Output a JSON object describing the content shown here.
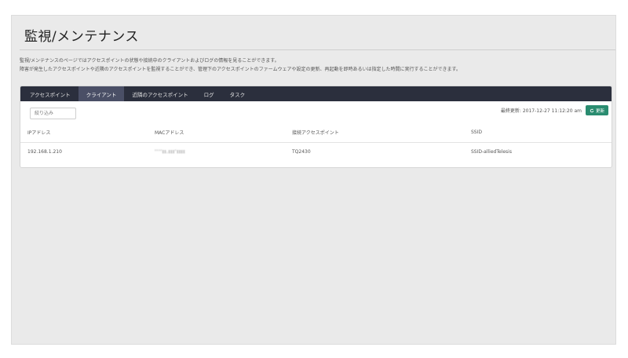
{
  "header": {
    "title": "監視/メンテナンス",
    "description": [
      "監視/メンテナンスのページではアクセスポイントの状態や接続中のクライアントおよびログの情報を見ることができます。",
      "障害が発生したアクセスポイントや近隣のアクセスポイントを監視することができ、管理下のアクセスポイントのファームウェアや設定の更新、再起動を即時あるいは指定した時間に実行することができます。"
    ]
  },
  "tabs": [
    {
      "label": "アクセスポイント",
      "active": false
    },
    {
      "label": "クライアント",
      "active": true
    },
    {
      "label": "近隣のアクセスポイント",
      "active": false
    },
    {
      "label": "ログ",
      "active": false
    },
    {
      "label": "タスク",
      "active": false
    }
  ],
  "toolbar": {
    "filter_placeholder": "絞り込み",
    "last_updated": "最終更新: 2017-12-27 11:12:20 am",
    "refresh_label": "更新",
    "refresh_icon": "refresh-icon",
    "refresh_color": "#2a8c70"
  },
  "table": {
    "columns": [
      "IPアドレス",
      "MACアドレス",
      "接続アクセスポイント",
      "SSID"
    ],
    "rows": [
      [
        "192.168.1.210",
        "ʻʻʻʻɪɪ.ɪɪɪʼɪɪɪɪ",
        "TQ2430",
        "SSID-alliedTelesis"
      ]
    ]
  },
  "colors": {
    "tab_bar": "#2b2f3d",
    "tab_active": "#4a4f66",
    "background": "#eaeaea"
  }
}
